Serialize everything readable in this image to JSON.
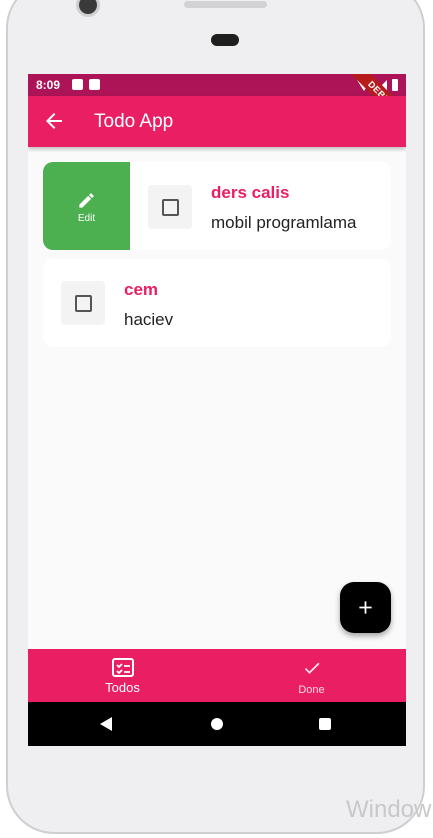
{
  "status_bar": {
    "time": "8:09",
    "debug_banner": "DEBUG"
  },
  "app_bar": {
    "title": "Todo App",
    "back_icon": "arrow-back-icon"
  },
  "todos": [
    {
      "title": "ders calis",
      "description": "mobil programlama",
      "checked": false,
      "swipe_action_label": "Edit"
    },
    {
      "title": "cem",
      "description": "haciev",
      "checked": false
    }
  ],
  "fab": {
    "icon": "plus-icon"
  },
  "bottom_nav": [
    {
      "label": "Todos",
      "icon": "checklist-icon",
      "active": true
    },
    {
      "label": "Done",
      "icon": "check-icon",
      "active": false
    }
  ],
  "watermark": "Window",
  "colors": {
    "primary": "#e91e63",
    "primary_dark": "#ad1457",
    "edit_green": "#4caf50",
    "fab_bg": "#000000"
  }
}
